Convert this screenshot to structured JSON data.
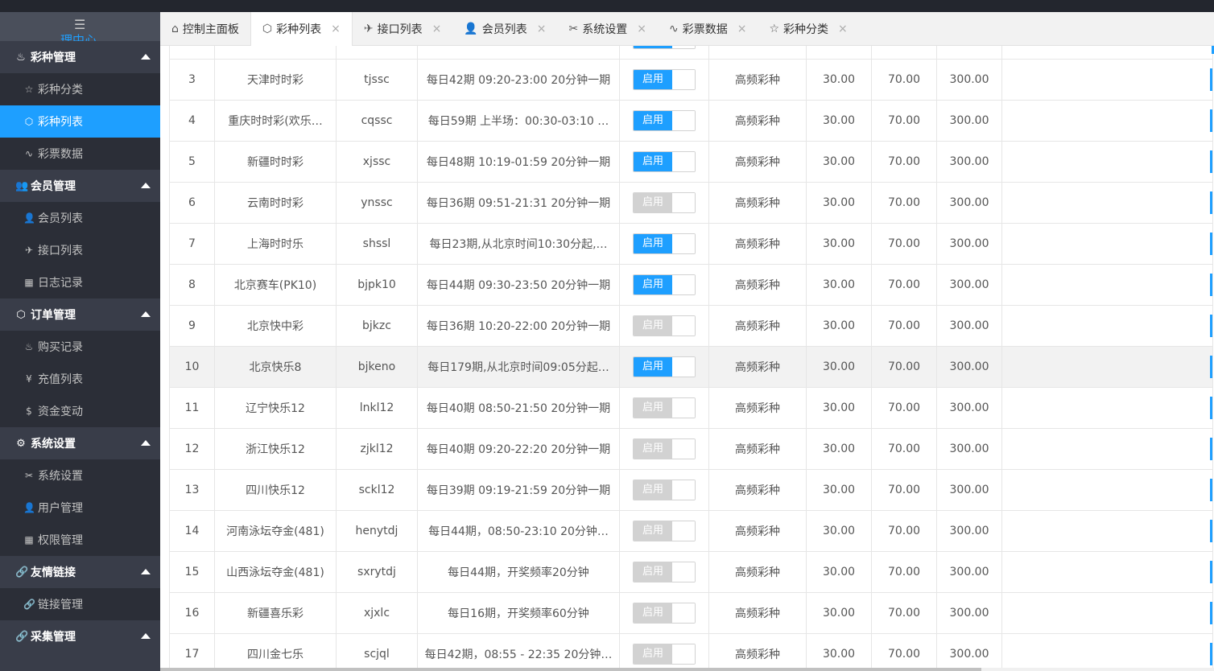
{
  "sidebar": {
    "toggle": "☰",
    "brand": "理中心",
    "groups": [
      {
        "title": "彩种管理",
        "icon": "fire-icon",
        "glyph": "♨",
        "items": [
          {
            "label": "彩种分类",
            "icon": "star-icon",
            "glyph": "☆",
            "active": false
          },
          {
            "label": "彩种列表",
            "icon": "cube-icon",
            "glyph": "⬡",
            "active": true
          },
          {
            "label": "彩票数据",
            "icon": "pulse-icon",
            "glyph": "∿",
            "active": false
          }
        ]
      },
      {
        "title": "会员管理",
        "icon": "users-icon",
        "glyph": "👥",
        "items": [
          {
            "label": "会员列表",
            "icon": "user-icon",
            "glyph": "👤",
            "active": false
          },
          {
            "label": "接口列表",
            "icon": "paper-plane-icon",
            "glyph": "✈",
            "active": false
          },
          {
            "label": "日志记录",
            "icon": "calendar-icon",
            "glyph": "▦",
            "active": false
          }
        ]
      },
      {
        "title": "订单管理",
        "icon": "cube-icon",
        "glyph": "⬡",
        "items": [
          {
            "label": "购买记录",
            "icon": "fire-icon",
            "glyph": "♨",
            "active": false
          },
          {
            "label": "充值列表",
            "icon": "yen-icon",
            "glyph": "¥",
            "active": false
          },
          {
            "label": "资金变动",
            "icon": "dollar-icon",
            "glyph": "$",
            "active": false
          }
        ]
      },
      {
        "title": "系统设置",
        "icon": "gear-icon",
        "glyph": "⚙",
        "items": [
          {
            "label": "系统设置",
            "icon": "tools-icon",
            "glyph": "✂",
            "active": false
          },
          {
            "label": "用户管理",
            "icon": "user-icon",
            "glyph": "👤",
            "active": false
          },
          {
            "label": "权限管理",
            "icon": "calendar-icon",
            "glyph": "▦",
            "active": false
          }
        ]
      },
      {
        "title": "友情链接",
        "icon": "link-icon",
        "glyph": "🔗",
        "items": [
          {
            "label": "链接管理",
            "icon": "link-icon",
            "glyph": "🔗",
            "active": false
          }
        ]
      },
      {
        "title": "采集管理",
        "icon": "link-icon",
        "glyph": "🔗",
        "items": []
      }
    ]
  },
  "tabs": [
    {
      "label": "控制主面板",
      "icon": "home-icon",
      "glyph": "⌂",
      "closable": false,
      "active": false
    },
    {
      "label": "彩种列表",
      "icon": "cube-icon",
      "glyph": "⬡",
      "closable": true,
      "active": true
    },
    {
      "label": "接口列表",
      "icon": "paper-plane-icon",
      "glyph": "✈",
      "closable": true,
      "active": false
    },
    {
      "label": "会员列表",
      "icon": "user-icon",
      "glyph": "👤",
      "closable": true,
      "active": false
    },
    {
      "label": "系统设置",
      "icon": "tools-icon",
      "glyph": "✂",
      "closable": true,
      "active": false
    },
    {
      "label": "彩票数据",
      "icon": "pulse-icon",
      "glyph": "∿",
      "closable": true,
      "active": false
    },
    {
      "label": "彩种分类",
      "icon": "star-icon",
      "glyph": "☆",
      "closable": true,
      "active": false
    }
  ],
  "close_glyph": "×",
  "switch_label": "启用",
  "table": {
    "rows": [
      {
        "id": "",
        "name": "",
        "code": "",
        "schedule": "",
        "enabled": true,
        "type": "",
        "v1": "",
        "v2": "",
        "v3": "",
        "partial": true
      },
      {
        "id": "3",
        "name": "天津时时彩",
        "code": "tjssc",
        "schedule": "每日42期 09:20-23:00 20分钟一期",
        "enabled": true,
        "type": "高频彩种",
        "v1": "30.00",
        "v2": "70.00",
        "v3": "300.00"
      },
      {
        "id": "4",
        "name": "重庆时时彩(欢乐…",
        "code": "cqssc",
        "schedule": "每日59期 上半场：00:30-03:10 …",
        "enabled": true,
        "type": "高频彩种",
        "v1": "30.00",
        "v2": "70.00",
        "v3": "300.00"
      },
      {
        "id": "5",
        "name": "新疆时时彩",
        "code": "xjssc",
        "schedule": "每日48期 10:19-01:59 20分钟一期",
        "enabled": true,
        "type": "高频彩种",
        "v1": "30.00",
        "v2": "70.00",
        "v3": "300.00"
      },
      {
        "id": "6",
        "name": "云南时时彩",
        "code": "ynssc",
        "schedule": "每日36期 09:51-21:31 20分钟一期",
        "enabled": false,
        "type": "高频彩种",
        "v1": "30.00",
        "v2": "70.00",
        "v3": "300.00"
      },
      {
        "id": "7",
        "name": "上海时时乐",
        "code": "shssl",
        "schedule": "每日23期,从北京时间10:30分起,…",
        "enabled": true,
        "type": "高频彩种",
        "v1": "30.00",
        "v2": "70.00",
        "v3": "300.00"
      },
      {
        "id": "8",
        "name": "北京赛车(PK10)",
        "code": "bjpk10",
        "schedule": "每日44期 09:30-23:50 20分钟一期",
        "enabled": true,
        "type": "高频彩种",
        "v1": "30.00",
        "v2": "70.00",
        "v3": "300.00"
      },
      {
        "id": "9",
        "name": "北京快中彩",
        "code": "bjkzc",
        "schedule": "每日36期 10:20-22:00 20分钟一期",
        "enabled": false,
        "type": "高频彩种",
        "v1": "30.00",
        "v2": "70.00",
        "v3": "300.00"
      },
      {
        "id": "10",
        "name": "北京快乐8",
        "code": "bjkeno",
        "schedule": "每日179期,从北京时间09:05分起…",
        "enabled": true,
        "type": "高频彩种",
        "v1": "30.00",
        "v2": "70.00",
        "v3": "300.00",
        "hover": true
      },
      {
        "id": "11",
        "name": "辽宁快乐12",
        "code": "lnkl12",
        "schedule": "每日40期 08:50-21:50 20分钟一期",
        "enabled": false,
        "type": "高频彩种",
        "v1": "30.00",
        "v2": "70.00",
        "v3": "300.00"
      },
      {
        "id": "12",
        "name": "浙江快乐12",
        "code": "zjkl12",
        "schedule": "每日40期 09:20-22:20 20分钟一期",
        "enabled": false,
        "type": "高频彩种",
        "v1": "30.00",
        "v2": "70.00",
        "v3": "300.00"
      },
      {
        "id": "13",
        "name": "四川快乐12",
        "code": "sckl12",
        "schedule": "每日39期 09:19-21:59 20分钟一期",
        "enabled": false,
        "type": "高频彩种",
        "v1": "30.00",
        "v2": "70.00",
        "v3": "300.00"
      },
      {
        "id": "14",
        "name": "河南泳坛夺金(481)",
        "code": "henytdj",
        "schedule": "每日44期，08:50-23:10 20分钟…",
        "enabled": false,
        "type": "高频彩种",
        "v1": "30.00",
        "v2": "70.00",
        "v3": "300.00"
      },
      {
        "id": "15",
        "name": "山西泳坛夺金(481)",
        "code": "sxrytdj",
        "schedule": "每日44期，开奖频率20分钟",
        "enabled": false,
        "type": "高频彩种",
        "v1": "30.00",
        "v2": "70.00",
        "v3": "300.00"
      },
      {
        "id": "16",
        "name": "新疆喜乐彩",
        "code": "xjxlc",
        "schedule": "每日16期，开奖频率60分钟",
        "enabled": false,
        "type": "高频彩种",
        "v1": "30.00",
        "v2": "70.00",
        "v3": "300.00"
      },
      {
        "id": "17",
        "name": "四川金七乐",
        "code": "scjql",
        "schedule": "每日42期，08:55 - 22:35 20分钟…",
        "enabled": false,
        "type": "高频彩种",
        "v1": "30.00",
        "v2": "70.00",
        "v3": "300.00"
      }
    ]
  }
}
